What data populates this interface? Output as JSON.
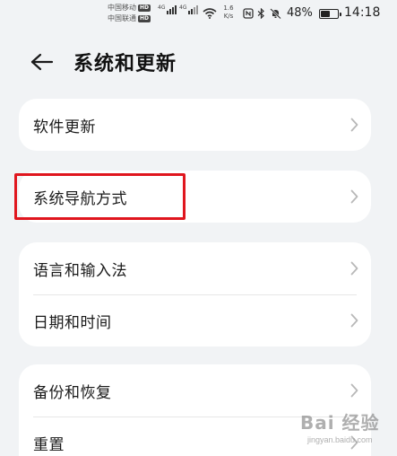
{
  "status_bar": {
    "carrier1": "中国移动",
    "carrier2": "中国联通",
    "hd": "HD",
    "network1": "4G",
    "network2": "4G",
    "speed_value": "1.6",
    "speed_unit": "K/s",
    "battery_percent": "48%",
    "battery_level": 0.48,
    "time": "14:18"
  },
  "header": {
    "title": "系统和更新"
  },
  "groups": [
    {
      "items": [
        {
          "label": "软件更新"
        }
      ]
    },
    {
      "items": [
        {
          "label": "系统导航方式"
        }
      ]
    },
    {
      "items": [
        {
          "label": "语言和输入法"
        },
        {
          "label": "日期和时间"
        }
      ]
    },
    {
      "items": [
        {
          "label": "备份和恢复"
        },
        {
          "label": "重置"
        }
      ]
    }
  ],
  "watermark": {
    "logo_text": "Bai 经验",
    "sub_text": "jingyan.baidu.com"
  },
  "colors": {
    "background": "#f1f3f5",
    "card": "#ffffff",
    "highlight": "#e0161e",
    "chevron": "#b8b8b8"
  }
}
